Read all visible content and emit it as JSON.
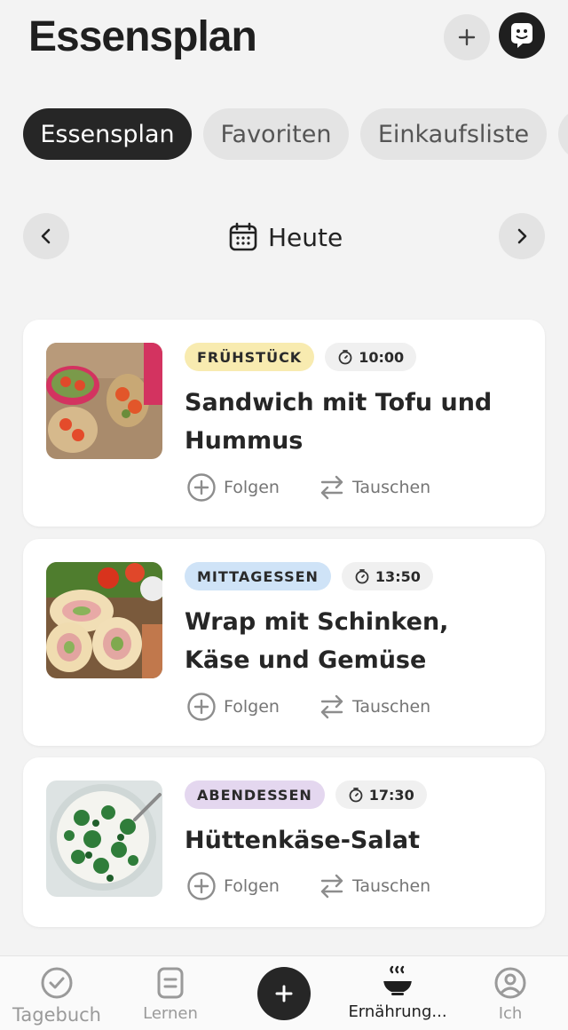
{
  "header": {
    "title": "Essensplan"
  },
  "tabs": [
    {
      "label": "Essensplan"
    },
    {
      "label": "Favoriten"
    },
    {
      "label": "Einkaufsliste"
    }
  ],
  "date_nav": {
    "label": "Heute"
  },
  "meals": [
    {
      "category": "FRÜHSTÜCK",
      "category_color": "#f8ebb0",
      "time": "10:00",
      "title": "Sandwich mit Tofu und Hummus",
      "follow_label": "Folgen",
      "swap_label": "Tauschen"
    },
    {
      "category": "MITTAGESSEN",
      "category_color": "#cfe3f7",
      "time": "13:50",
      "title": "Wrap mit Schinken, Käse und Gemüse",
      "follow_label": "Folgen",
      "swap_label": "Tauschen"
    },
    {
      "category": "ABENDESSEN",
      "category_color": "#e4d7ef",
      "time": "17:30",
      "title": "Hüttenkäse-Salat",
      "follow_label": "Folgen",
      "swap_label": "Tauschen"
    }
  ],
  "bottom_nav": [
    {
      "label": "Tagebuch",
      "icon": "check-circle-icon"
    },
    {
      "label": "Lernen",
      "icon": "document-icon"
    },
    {
      "label": "Ernährung...",
      "icon": "bowl-icon"
    },
    {
      "label": "Ich",
      "icon": "user-icon"
    }
  ]
}
